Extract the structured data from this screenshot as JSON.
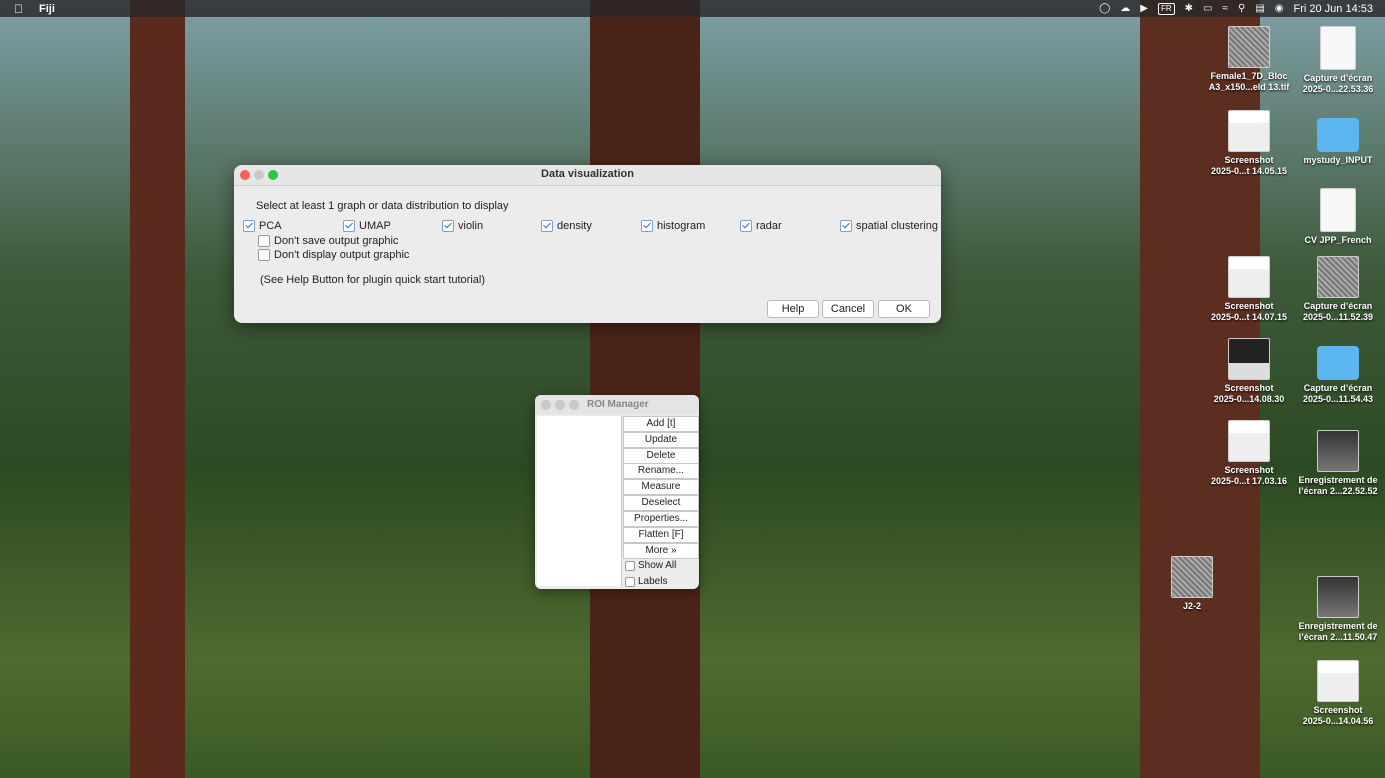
{
  "menubar": {
    "apple": "",
    "app": "Fiji",
    "kbd": "FR",
    "datetime": "Fri 20 Jun  14:53"
  },
  "dialog": {
    "title": "Data visualization",
    "instruction": "Select at least 1 graph or data distribution to display",
    "options": [
      {
        "label": "PCA",
        "checked": true
      },
      {
        "label": "UMAP",
        "checked": true
      },
      {
        "label": "violin",
        "checked": true
      },
      {
        "label": "density",
        "checked": true
      },
      {
        "label": "histogram",
        "checked": true
      },
      {
        "label": "radar",
        "checked": true
      },
      {
        "label": "spatial clustering",
        "checked": true
      }
    ],
    "dont_save": "Don't save output graphic",
    "dont_display": "Don't display output graphic",
    "help_note": "(See Help Button for plugin quick start tutorial)",
    "buttons": {
      "help": "Help",
      "cancel": "Cancel",
      "ok": "OK"
    }
  },
  "roi_manager": {
    "title": "ROI Manager",
    "buttons": [
      "Add [t]",
      "Update",
      "Delete",
      "Rename...",
      "Measure",
      "Deselect",
      "Properties...",
      "Flatten [F]",
      "More »"
    ],
    "show_all": "Show All",
    "labels": "Labels"
  },
  "desktop_icons": [
    {
      "l1": "Female1_7D_Bloc",
      "l2": "A3_x150...eld 13.tif"
    },
    {
      "l1": "Capture d’écran",
      "l2": "2025-0...22.53.36"
    },
    {
      "l1": "Screenshot",
      "l2": "2025-0...t 14.05.15"
    },
    {
      "l1": "mystudy_INPUT",
      "l2": ""
    },
    {
      "l1": "CV JPP_French",
      "l2": ""
    },
    {
      "l1": "Screenshot",
      "l2": "2025-0...t 14.07.15"
    },
    {
      "l1": "Capture d’écran",
      "l2": "2025-0...11.52.39"
    },
    {
      "l1": "Screenshot",
      "l2": "2025-0...14.08.30"
    },
    {
      "l1": "Capture d’écran",
      "l2": "2025-0...11.54.43"
    },
    {
      "l1": "Screenshot",
      "l2": "2025-0...t 17.03.16"
    },
    {
      "l1": "Enregistrement de",
      "l2": "l’écran 2...22.52.52"
    },
    {
      "l1": "J2-2",
      "l2": ""
    },
    {
      "l1": "Enregistrement de",
      "l2": "l’écran 2...11.50.47"
    },
    {
      "l1": "Screenshot",
      "l2": "2025-0...14.04.56"
    }
  ]
}
